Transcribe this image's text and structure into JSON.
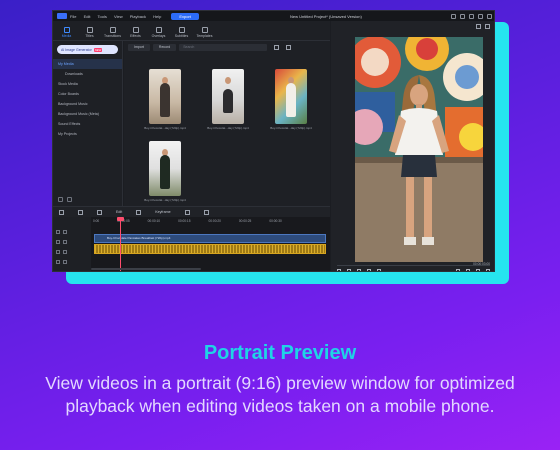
{
  "window": {
    "menu": [
      "File",
      "Edit",
      "Tools",
      "View",
      "Playback",
      "Help"
    ],
    "export_label": "Export",
    "project_title": "New Untitled Project* (Unsaved Version)"
  },
  "toolbar": {
    "tabs": [
      {
        "label": "Media",
        "active": true
      },
      {
        "label": "Titles"
      },
      {
        "label": "Transitions"
      },
      {
        "label": "Effects"
      },
      {
        "label": "Overlays"
      },
      {
        "label": "Subtitles"
      },
      {
        "label": "Templates"
      }
    ]
  },
  "sidebar": {
    "generator_label": "AI Image Generator",
    "generator_badge": "NEW",
    "items": [
      {
        "label": "My Media",
        "active": true
      },
      {
        "label": "Downloads",
        "sub": true
      },
      {
        "label": "Stock Media"
      },
      {
        "label": "Color Boards"
      },
      {
        "label": "Background Music"
      },
      {
        "label": "Background Music (Meta)"
      },
      {
        "label": "Sound Effects"
      },
      {
        "label": "My Projects"
      }
    ]
  },
  "media": {
    "import_label": "Import",
    "record_label": "Record",
    "search_placeholder": "Search",
    "items": [
      {
        "caption": "Boy-Chocolat...day (720p).mp4"
      },
      {
        "caption": "Boy-Chocolat...day (720p).mp4"
      },
      {
        "caption": "Boy-Chocolat...day (720p).mp4"
      },
      {
        "caption": "Boy-Chocolat...day (720p).mp4"
      }
    ]
  },
  "timeline": {
    "tools": [
      "Edit",
      "Keyframe"
    ],
    "ruler": [
      "0:00",
      "00:00:05",
      "00:00:10",
      "00:00:15",
      "00:00:20",
      "00:00:25",
      "00:00:30"
    ],
    "video_clip": "Boy-Chocolate Pancakes Breakfast (720p).mp4",
    "playhead_position": 0.12
  },
  "preview": {
    "timecode": "00:00:03:00"
  },
  "caption": {
    "title": "Portrait Preview",
    "body": "View videos in a portrait (9:16) preview window for optimized playback when editing videos taken on a mobile phone."
  }
}
